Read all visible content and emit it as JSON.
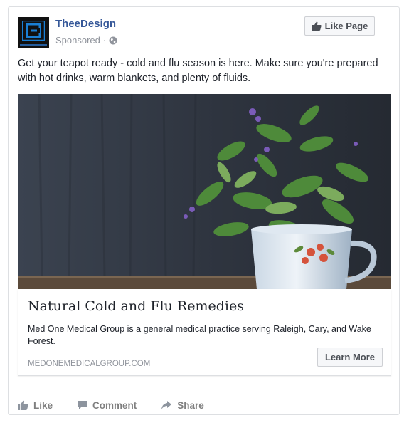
{
  "post": {
    "page_name": "TheeDesign",
    "sponsored_label": "Sponsored · ",
    "privacy_icon": "globe-icon",
    "like_page_label": "Like Page",
    "text": "Get your teapot ready - cold and flu season is here. Make sure you're prepared with hot drinks, warm blankets, and plenty of fluids."
  },
  "link": {
    "title": "Natural Cold and Flu Remedies",
    "description": "Med One Medical Group is a general medical practice serving Raleigh, Cary, and Wake Forest.",
    "domain": "MEDONEMEDICALGROUP.COM",
    "cta_label": "Learn More"
  },
  "actions": [
    {
      "label": "Like",
      "icon": "thumbs-up-icon"
    },
    {
      "label": "Comment",
      "icon": "comment-icon"
    },
    {
      "label": "Share",
      "icon": "share-icon"
    }
  ],
  "colors": {
    "brand_blue": "#365899",
    "meta_gray": "#90949c",
    "logo_blue": "#1a7fd4"
  }
}
